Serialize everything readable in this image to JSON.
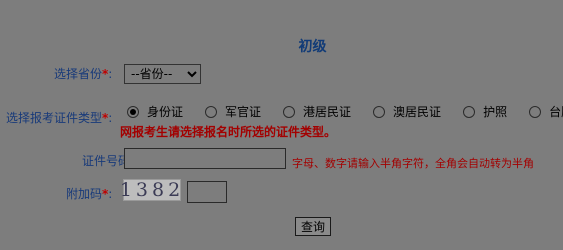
{
  "title": "初级",
  "province": {
    "label": "选择省份",
    "required": "*",
    "separator": ":",
    "selected": "--省份--"
  },
  "cert_type": {
    "label": "选择报考证件类型",
    "required": "*",
    "separator": ":",
    "options": [
      "身份证",
      "军官证",
      "港居民证",
      "澳居民证",
      "护照",
      "台胞证"
    ],
    "selected_index": 0,
    "notice": "网报考生请选择报名时所选的证件类型。"
  },
  "cert_number": {
    "label": "证件号码",
    "required": "*",
    "separator": ":",
    "value": "",
    "hint": "字母、数字请输入半角字符，全角会自动转为半角"
  },
  "captcha": {
    "label": "附加码",
    "required": "*",
    "separator": ":",
    "image_text": "1382",
    "value": ""
  },
  "submit_label": "查询"
}
